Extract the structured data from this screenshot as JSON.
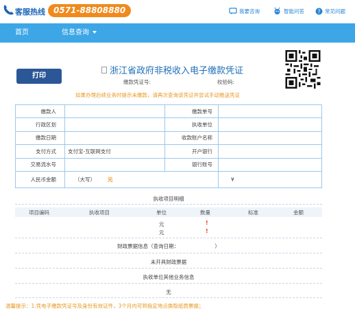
{
  "header": {
    "hotline_label": "客服热线",
    "hotline_number": "0571-88808880",
    "links": [
      {
        "label": "我要咨询",
        "icon": "chat-icon"
      },
      {
        "label": "智能问答",
        "icon": "robot-icon"
      },
      {
        "label": "常见问题",
        "icon": "question-icon"
      }
    ]
  },
  "nav": {
    "home": "首页",
    "info_query": "信息查询"
  },
  "document": {
    "print_label": "打印",
    "title": "浙江省政府非税收入电子缴款凭证",
    "cert_no_label": "缴款凭证号:",
    "verify_code_label": "校验码:",
    "notice": "如果办理后续业务时提示未缴款，请再次查询该凭证并尝试手动推送凭证"
  },
  "info_table": {
    "rows": [
      {
        "l1": "缴款人",
        "v1": "",
        "l2": "缴款单号",
        "v2": ""
      },
      {
        "l1": "行政区划",
        "v1": "",
        "l2": "执收单位",
        "v2": ""
      },
      {
        "l1": "缴款日期",
        "v1": "",
        "l2": "收款账户名称",
        "v2": ""
      },
      {
        "l1": "支付方式",
        "v1": "支付宝-互联网支付",
        "l2": "开户银行",
        "v2": ""
      },
      {
        "l1": "交易流水号",
        "v1": "",
        "l2": "银行账号",
        "v2": ""
      }
    ],
    "amount_label": "人民币金额",
    "amount_capital": "（大写）",
    "amount_unit": "元",
    "amount_yen": "¥"
  },
  "items": {
    "title": "执收项目明细",
    "columns": [
      "项目编码",
      "执收项目",
      "单位",
      "数量",
      "标准",
      "金额"
    ],
    "rows": [
      {
        "unit": "元",
        "qty": "!"
      },
      {
        "unit": "元",
        "qty": "!"
      }
    ]
  },
  "fiscal": {
    "title": "财政票据信息（查询日期：",
    "close": "）",
    "no_receipt": "未开具财政票据",
    "other_info": "执收单位其他业务信息",
    "none": "无"
  },
  "reminder": "温馨提示：1.凭电子缴款凭证号及身份有效证件，3个月内可到指定地点换取纸质票据；",
  "colors": {
    "nav_bg": "#3ca6e6",
    "print_btn": "#2b5797",
    "title": "#1e6fb8",
    "warning": "#e8961e",
    "hotline_bg": "#f08a1c"
  }
}
